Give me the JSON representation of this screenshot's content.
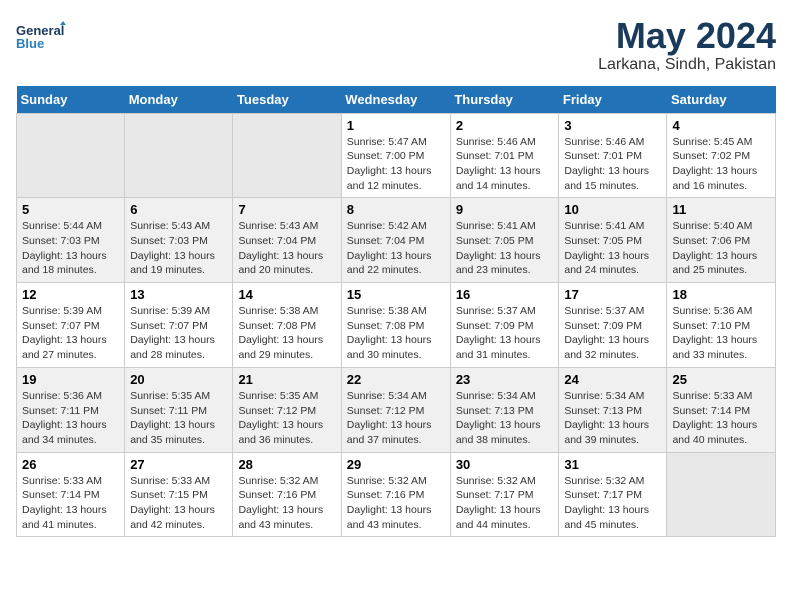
{
  "logo": {
    "text_general": "General",
    "text_blue": "Blue"
  },
  "header": {
    "month": "May 2024",
    "location": "Larkana, Sindh, Pakistan"
  },
  "weekdays": [
    "Sunday",
    "Monday",
    "Tuesday",
    "Wednesday",
    "Thursday",
    "Friday",
    "Saturday"
  ],
  "weeks": [
    [
      {
        "day": "",
        "sunrise": "",
        "sunset": "",
        "daylight": ""
      },
      {
        "day": "",
        "sunrise": "",
        "sunset": "",
        "daylight": ""
      },
      {
        "day": "",
        "sunrise": "",
        "sunset": "",
        "daylight": ""
      },
      {
        "day": "1",
        "sunrise": "Sunrise: 5:47 AM",
        "sunset": "Sunset: 7:00 PM",
        "daylight": "Daylight: 13 hours and 12 minutes."
      },
      {
        "day": "2",
        "sunrise": "Sunrise: 5:46 AM",
        "sunset": "Sunset: 7:01 PM",
        "daylight": "Daylight: 13 hours and 14 minutes."
      },
      {
        "day": "3",
        "sunrise": "Sunrise: 5:46 AM",
        "sunset": "Sunset: 7:01 PM",
        "daylight": "Daylight: 13 hours and 15 minutes."
      },
      {
        "day": "4",
        "sunrise": "Sunrise: 5:45 AM",
        "sunset": "Sunset: 7:02 PM",
        "daylight": "Daylight: 13 hours and 16 minutes."
      }
    ],
    [
      {
        "day": "5",
        "sunrise": "Sunrise: 5:44 AM",
        "sunset": "Sunset: 7:03 PM",
        "daylight": "Daylight: 13 hours and 18 minutes."
      },
      {
        "day": "6",
        "sunrise": "Sunrise: 5:43 AM",
        "sunset": "Sunset: 7:03 PM",
        "daylight": "Daylight: 13 hours and 19 minutes."
      },
      {
        "day": "7",
        "sunrise": "Sunrise: 5:43 AM",
        "sunset": "Sunset: 7:04 PM",
        "daylight": "Daylight: 13 hours and 20 minutes."
      },
      {
        "day": "8",
        "sunrise": "Sunrise: 5:42 AM",
        "sunset": "Sunset: 7:04 PM",
        "daylight": "Daylight: 13 hours and 22 minutes."
      },
      {
        "day": "9",
        "sunrise": "Sunrise: 5:41 AM",
        "sunset": "Sunset: 7:05 PM",
        "daylight": "Daylight: 13 hours and 23 minutes."
      },
      {
        "day": "10",
        "sunrise": "Sunrise: 5:41 AM",
        "sunset": "Sunset: 7:05 PM",
        "daylight": "Daylight: 13 hours and 24 minutes."
      },
      {
        "day": "11",
        "sunrise": "Sunrise: 5:40 AM",
        "sunset": "Sunset: 7:06 PM",
        "daylight": "Daylight: 13 hours and 25 minutes."
      }
    ],
    [
      {
        "day": "12",
        "sunrise": "Sunrise: 5:39 AM",
        "sunset": "Sunset: 7:07 PM",
        "daylight": "Daylight: 13 hours and 27 minutes."
      },
      {
        "day": "13",
        "sunrise": "Sunrise: 5:39 AM",
        "sunset": "Sunset: 7:07 PM",
        "daylight": "Daylight: 13 hours and 28 minutes."
      },
      {
        "day": "14",
        "sunrise": "Sunrise: 5:38 AM",
        "sunset": "Sunset: 7:08 PM",
        "daylight": "Daylight: 13 hours and 29 minutes."
      },
      {
        "day": "15",
        "sunrise": "Sunrise: 5:38 AM",
        "sunset": "Sunset: 7:08 PM",
        "daylight": "Daylight: 13 hours and 30 minutes."
      },
      {
        "day": "16",
        "sunrise": "Sunrise: 5:37 AM",
        "sunset": "Sunset: 7:09 PM",
        "daylight": "Daylight: 13 hours and 31 minutes."
      },
      {
        "day": "17",
        "sunrise": "Sunrise: 5:37 AM",
        "sunset": "Sunset: 7:09 PM",
        "daylight": "Daylight: 13 hours and 32 minutes."
      },
      {
        "day": "18",
        "sunrise": "Sunrise: 5:36 AM",
        "sunset": "Sunset: 7:10 PM",
        "daylight": "Daylight: 13 hours and 33 minutes."
      }
    ],
    [
      {
        "day": "19",
        "sunrise": "Sunrise: 5:36 AM",
        "sunset": "Sunset: 7:11 PM",
        "daylight": "Daylight: 13 hours and 34 minutes."
      },
      {
        "day": "20",
        "sunrise": "Sunrise: 5:35 AM",
        "sunset": "Sunset: 7:11 PM",
        "daylight": "Daylight: 13 hours and 35 minutes."
      },
      {
        "day": "21",
        "sunrise": "Sunrise: 5:35 AM",
        "sunset": "Sunset: 7:12 PM",
        "daylight": "Daylight: 13 hours and 36 minutes."
      },
      {
        "day": "22",
        "sunrise": "Sunrise: 5:34 AM",
        "sunset": "Sunset: 7:12 PM",
        "daylight": "Daylight: 13 hours and 37 minutes."
      },
      {
        "day": "23",
        "sunrise": "Sunrise: 5:34 AM",
        "sunset": "Sunset: 7:13 PM",
        "daylight": "Daylight: 13 hours and 38 minutes."
      },
      {
        "day": "24",
        "sunrise": "Sunrise: 5:34 AM",
        "sunset": "Sunset: 7:13 PM",
        "daylight": "Daylight: 13 hours and 39 minutes."
      },
      {
        "day": "25",
        "sunrise": "Sunrise: 5:33 AM",
        "sunset": "Sunset: 7:14 PM",
        "daylight": "Daylight: 13 hours and 40 minutes."
      }
    ],
    [
      {
        "day": "26",
        "sunrise": "Sunrise: 5:33 AM",
        "sunset": "Sunset: 7:14 PM",
        "daylight": "Daylight: 13 hours and 41 minutes."
      },
      {
        "day": "27",
        "sunrise": "Sunrise: 5:33 AM",
        "sunset": "Sunset: 7:15 PM",
        "daylight": "Daylight: 13 hours and 42 minutes."
      },
      {
        "day": "28",
        "sunrise": "Sunrise: 5:32 AM",
        "sunset": "Sunset: 7:16 PM",
        "daylight": "Daylight: 13 hours and 43 minutes."
      },
      {
        "day": "29",
        "sunrise": "Sunrise: 5:32 AM",
        "sunset": "Sunset: 7:16 PM",
        "daylight": "Daylight: 13 hours and 43 minutes."
      },
      {
        "day": "30",
        "sunrise": "Sunrise: 5:32 AM",
        "sunset": "Sunset: 7:17 PM",
        "daylight": "Daylight: 13 hours and 44 minutes."
      },
      {
        "day": "31",
        "sunrise": "Sunrise: 5:32 AM",
        "sunset": "Sunset: 7:17 PM",
        "daylight": "Daylight: 13 hours and 45 minutes."
      },
      {
        "day": "",
        "sunrise": "",
        "sunset": "",
        "daylight": ""
      }
    ]
  ]
}
